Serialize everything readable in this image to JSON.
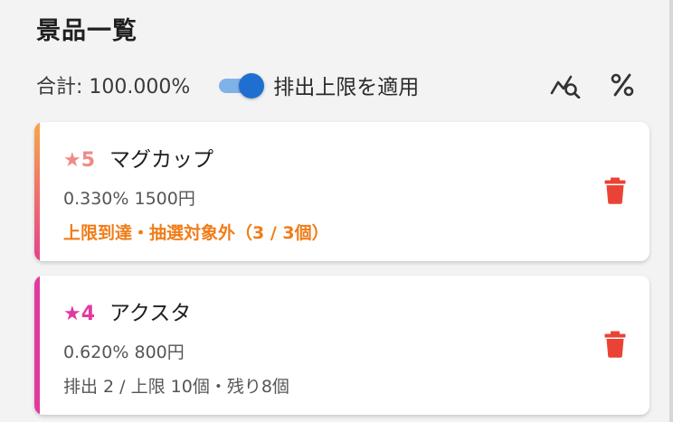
{
  "header": {
    "title": "景品一覧"
  },
  "summary": {
    "total": "合計: 100.000%",
    "toggle_label": "排出上限を適用",
    "toggle_on": true
  },
  "colors": {
    "toggle_track": "#7fb3e8",
    "toggle_thumb": "#1f6fd1",
    "delete_icon": "#ea4335",
    "alert_text": "#f07d1a",
    "star4": "#e03aa0"
  },
  "icons": {
    "analytics": "analytics-icon",
    "percent": "percent-icon",
    "delete": "trash-icon"
  },
  "prizes": [
    {
      "stars": "★5",
      "name": "マグカップ",
      "meta": "0.330% 1500円",
      "status": "上限到達・抽選対象外（3 / 3個）"
    },
    {
      "stars": "★4",
      "name": "アクスタ",
      "meta": "0.620% 800円",
      "status": "排出 2 / 上限 10個・残り8個"
    }
  ]
}
